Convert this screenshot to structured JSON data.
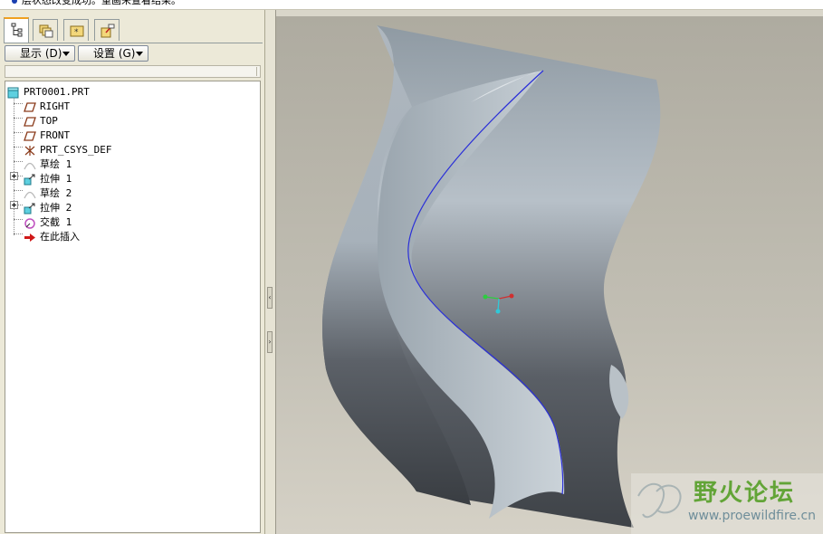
{
  "message_bar": {
    "text": "层状态改变成功。重画来查看结果。"
  },
  "nav_tabs": [
    {
      "name": "model-tree-tab",
      "icon": "model-tree-icon",
      "active": true
    },
    {
      "name": "folder-browser-tab",
      "icon": "folder-browser-icon",
      "active": false
    },
    {
      "name": "favorites-tab",
      "icon": "favorites-icon",
      "active": false
    },
    {
      "name": "connections-tab",
      "icon": "connections-icon",
      "active": false
    }
  ],
  "toolbar": {
    "show_label": "显示 (D)",
    "settings_label": "设置 (G)"
  },
  "tree": {
    "items": [
      {
        "label": "PRT0001.PRT",
        "icon": "part-icon"
      },
      {
        "label": "RIGHT",
        "icon": "datum-plane-icon"
      },
      {
        "label": "TOP",
        "icon": "datum-plane-icon"
      },
      {
        "label": "FRONT",
        "icon": "datum-plane-icon"
      },
      {
        "label": "PRT_CSYS_DEF",
        "icon": "coordinate-system-icon"
      },
      {
        "label": "草绘 1",
        "icon": "sketch-icon"
      },
      {
        "label": "拉伸 1",
        "icon": "extrude-icon"
      },
      {
        "label": "草绘 2",
        "icon": "sketch-icon"
      },
      {
        "label": "拉伸 2",
        "icon": "extrude-icon"
      },
      {
        "label": "交截 1",
        "icon": "intersect-icon"
      },
      {
        "label": "在此插入",
        "icon": "insert-here-arrow-icon"
      }
    ]
  },
  "watermark": {
    "title": "野火论坛",
    "url": "www.proewildfire.cn"
  },
  "colors": {
    "viewport_bg": "#bdbab0",
    "surface_dark": "#4a4d52",
    "surface_light": "#b3bcc4",
    "curve": "#2a2fd8",
    "watermark_green": "#62a437"
  }
}
